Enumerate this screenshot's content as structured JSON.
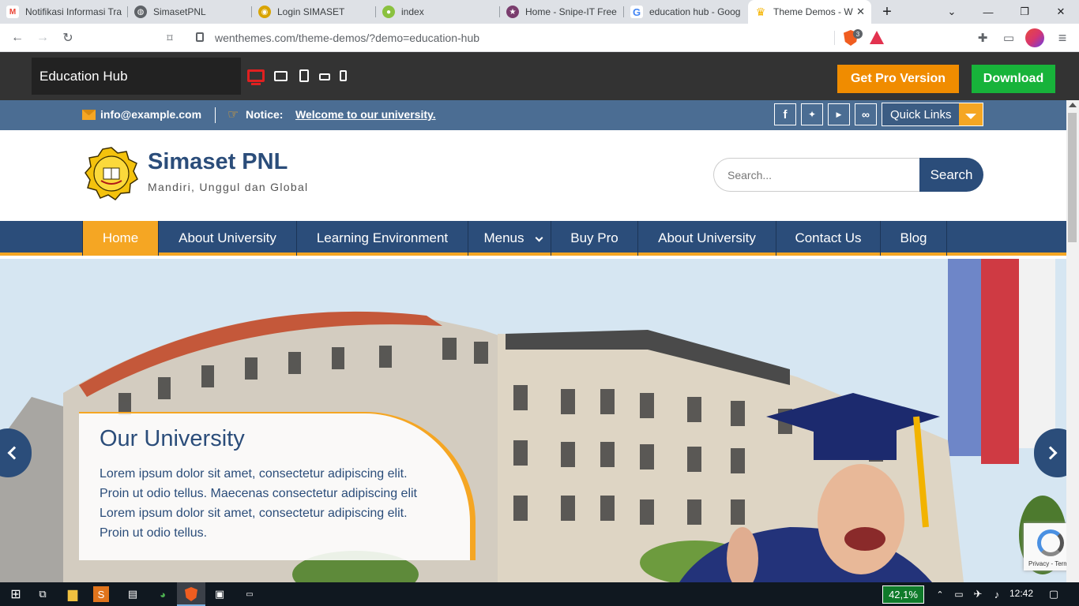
{
  "browser": {
    "tabs": [
      {
        "title": "Notifikasi Informasi Tra",
        "icon": "gmail-icon"
      },
      {
        "title": "SimasetPNL",
        "icon": "globe-icon"
      },
      {
        "title": "Login SIMASET",
        "icon": "seal-icon"
      },
      {
        "title": "index",
        "icon": "chrome-icon"
      },
      {
        "title": "Home - Snipe-IT Free",
        "icon": "snipe-icon"
      },
      {
        "title": "education hub - Goog",
        "icon": "google-icon"
      },
      {
        "title": "Theme Demos - W",
        "icon": "crown-icon"
      }
    ],
    "url": "wenthemes.com/theme-demos/?demo=education-hub",
    "shield_count": "3"
  },
  "demo_bar": {
    "theme_name": "Education Hub",
    "pro_label": "Get Pro Version",
    "download_label": "Download"
  },
  "site": {
    "topbar": {
      "email": "info@example.com",
      "notice_label": "Notice:",
      "notice_text": "Welcome to our university.",
      "quick_links": "Quick Links",
      "social": [
        "facebook-icon",
        "twitter-icon",
        "youtube-icon",
        "link-icon"
      ]
    },
    "header": {
      "site_title": "Simaset PNL",
      "tagline": "Mandiri, Unggul dan Global",
      "search_placeholder": "Search...",
      "search_button": "Search"
    },
    "nav": {
      "items": [
        "Home",
        "About University",
        "Learning Environment",
        "Menus",
        "Buy Pro",
        "About University",
        "Contact Us",
        "Blog"
      ]
    },
    "hero": {
      "title": "Our University",
      "text": "Lorem ipsum dolor sit amet, consectetur adipiscing elit. Proin ut odio tellus. Maecenas consectetur adipiscing elit Lorem ipsum dolor sit amet, consectetur adipiscing elit. Proin ut odio tellus."
    },
    "recaptcha": "Privacy - Terms"
  },
  "taskbar": {
    "counter": "42,1%",
    "clock": "12:42"
  },
  "colors": {
    "brand_blue": "#2b4d7a",
    "accent_orange": "#f5a623",
    "topbar_blue": "#4b6d93",
    "download_green": "#17b33a",
    "pro_orange": "#f08c00"
  }
}
